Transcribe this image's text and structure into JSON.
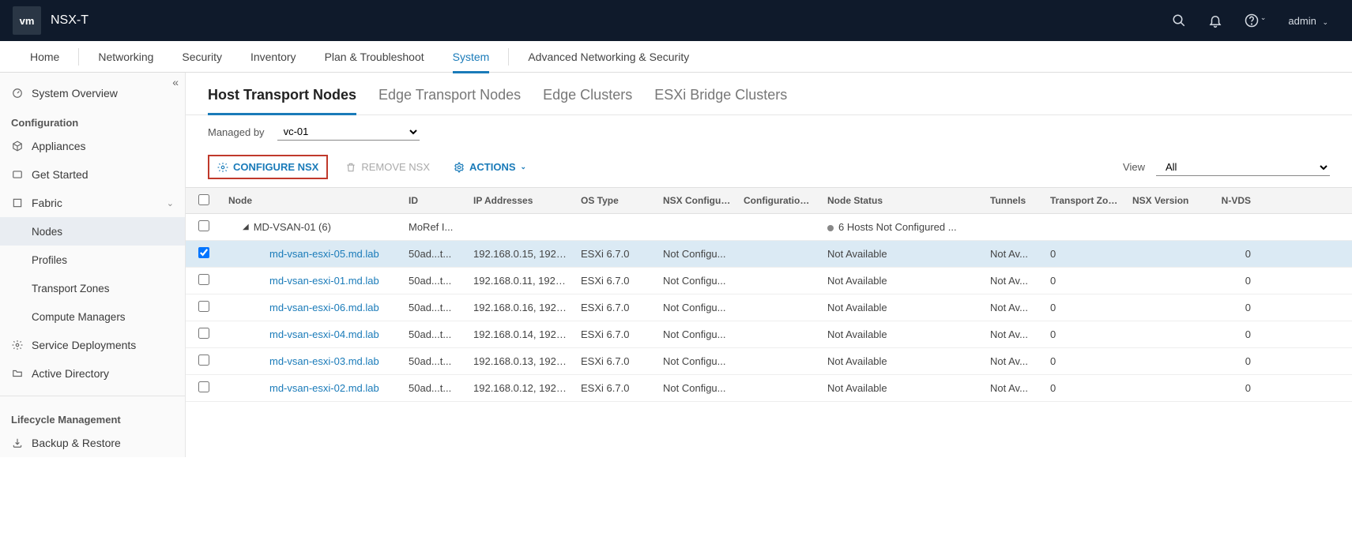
{
  "app": {
    "logo": "vm",
    "title": "NSX-T",
    "user": "admin"
  },
  "nav": {
    "items": [
      "Home",
      "Networking",
      "Security",
      "Inventory",
      "Plan & Troubleshoot",
      "System",
      "Advanced Networking & Security"
    ],
    "active": 5
  },
  "sidebar": {
    "overview": "System Overview",
    "group_config": "Configuration",
    "appliances": "Appliances",
    "get_started": "Get Started",
    "fabric": "Fabric",
    "nodes": "Nodes",
    "profiles": "Profiles",
    "tzones": "Transport Zones",
    "cmanagers": "Compute Managers",
    "sdeploy": "Service Deployments",
    "ad": "Active Directory",
    "group_lc": "Lifecycle Management",
    "backup": "Backup & Restore"
  },
  "subtabs": [
    "Host Transport Nodes",
    "Edge Transport Nodes",
    "Edge Clusters",
    "ESXi Bridge Clusters"
  ],
  "managed": {
    "label": "Managed by",
    "value": "vc-01"
  },
  "toolbar": {
    "configure": "CONFIGURE NSX",
    "remove": "REMOVE NSX",
    "actions": "ACTIONS",
    "view_label": "View",
    "view_value": "All"
  },
  "columns": {
    "node": "Node",
    "id": "ID",
    "ip": "IP Addresses",
    "os": "OS Type",
    "nsx": "NSX Configurati",
    "cfg": "Configuration St",
    "stat": "Node Status",
    "tun": "Tunnels",
    "tz": "Transport Zones",
    "ver": "NSX Version",
    "nvds": "N-VDS"
  },
  "cluster": {
    "name": "MD-VSAN-01 (6)",
    "id": "MoRef I...",
    "status": "6 Hosts Not Configured ..."
  },
  "hosts": [
    {
      "sel": true,
      "name": "md-vsan-esxi-05.md.lab",
      "id": "50ad...t...",
      "ip": "192.168.0.15, 192.1...",
      "os": "ESXi 6.7.0",
      "nsx": "Not Configu...",
      "stat": "Not Available",
      "tun": "Not Av...",
      "tz": "0",
      "nvds": "0"
    },
    {
      "sel": false,
      "name": "md-vsan-esxi-01.md.lab",
      "id": "50ad...t...",
      "ip": "192.168.0.11, 192.1...",
      "os": "ESXi 6.7.0",
      "nsx": "Not Configu...",
      "stat": "Not Available",
      "tun": "Not Av...",
      "tz": "0",
      "nvds": "0"
    },
    {
      "sel": false,
      "name": "md-vsan-esxi-06.md.lab",
      "id": "50ad...t...",
      "ip": "192.168.0.16, 192.1...",
      "os": "ESXi 6.7.0",
      "nsx": "Not Configu...",
      "stat": "Not Available",
      "tun": "Not Av...",
      "tz": "0",
      "nvds": "0"
    },
    {
      "sel": false,
      "name": "md-vsan-esxi-04.md.lab",
      "id": "50ad...t...",
      "ip": "192.168.0.14, 192.1...",
      "os": "ESXi 6.7.0",
      "nsx": "Not Configu...",
      "stat": "Not Available",
      "tun": "Not Av...",
      "tz": "0",
      "nvds": "0"
    },
    {
      "sel": false,
      "name": "md-vsan-esxi-03.md.lab",
      "id": "50ad...t...",
      "ip": "192.168.0.13, 192.1...",
      "os": "ESXi 6.7.0",
      "nsx": "Not Configu...",
      "stat": "Not Available",
      "tun": "Not Av...",
      "tz": "0",
      "nvds": "0"
    },
    {
      "sel": false,
      "name": "md-vsan-esxi-02.md.lab",
      "id": "50ad...t...",
      "ip": "192.168.0.12, 192.1...",
      "os": "ESXi 6.7.0",
      "nsx": "Not Configu...",
      "stat": "Not Available",
      "tun": "Not Av...",
      "tz": "0",
      "nvds": "0"
    }
  ]
}
